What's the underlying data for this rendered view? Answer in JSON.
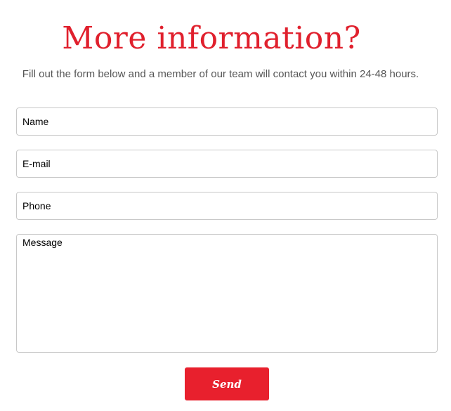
{
  "header": {
    "title": "More information?",
    "subtitle": "Fill out the form below and a member of our team will contact you within 24-48 hours."
  },
  "form": {
    "name_placeholder": "Name",
    "email_placeholder": "E-mail",
    "phone_placeholder": "Phone",
    "message_placeholder": "Message",
    "send_label": "Send"
  },
  "colors": {
    "accent": "#e8202d",
    "title": "#e0202d",
    "subtitle_text": "#555555",
    "field_border": "#c8c8c8"
  }
}
